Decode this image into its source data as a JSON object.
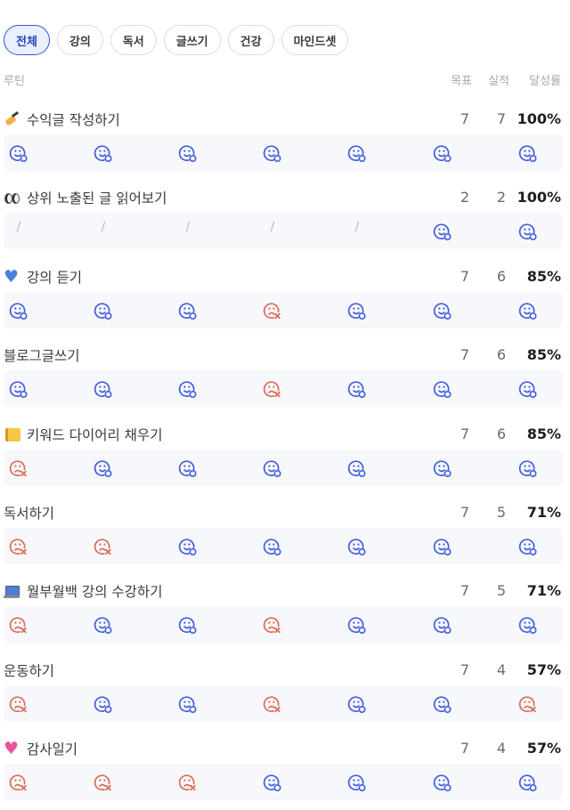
{
  "tabs": [
    "전체",
    "강의",
    "독서",
    "글쓰기",
    "건강",
    "마인드셋"
  ],
  "active_tab": 0,
  "header": {
    "name": "루틴",
    "goal": "목표",
    "actual": "실적",
    "rate": "달성률"
  },
  "colors": {
    "accent": "#3554d1",
    "success_icon": "#3f5ce0",
    "fail_icon": "#d96b55"
  },
  "routines": [
    {
      "emoji": "writing-hand",
      "title": "수익글 작성하기",
      "goal": "7",
      "actual": "7",
      "rate": "100%",
      "days": [
        "done",
        "done",
        "done",
        "done",
        "done",
        "done",
        "done"
      ]
    },
    {
      "emoji": "eyes",
      "title": "상위 노출된 글 읽어보기",
      "goal": "2",
      "actual": "2",
      "rate": "100%",
      "days": [
        "none",
        "none",
        "none",
        "none",
        "none",
        "done",
        "done"
      ]
    },
    {
      "emoji": "blue-heart",
      "title": "강의 듣기",
      "goal": "7",
      "actual": "6",
      "rate": "85%",
      "days": [
        "done",
        "done",
        "done",
        "fail",
        "done",
        "done",
        "done"
      ]
    },
    {
      "emoji": "",
      "title": "블로그글쓰기",
      "goal": "7",
      "actual": "6",
      "rate": "85%",
      "days": [
        "done",
        "done",
        "done",
        "fail",
        "done",
        "done",
        "done"
      ]
    },
    {
      "emoji": "notepad",
      "title": "키워드 다이어리 채우기",
      "goal": "7",
      "actual": "6",
      "rate": "85%",
      "days": [
        "fail",
        "done",
        "done",
        "done",
        "done",
        "done",
        "done"
      ]
    },
    {
      "emoji": "",
      "title": "독서하기",
      "goal": "7",
      "actual": "5",
      "rate": "71%",
      "days": [
        "fail",
        "fail",
        "done",
        "done",
        "done",
        "done",
        "done"
      ]
    },
    {
      "emoji": "laptop",
      "title": "월부월백 강의 수강하기",
      "goal": "7",
      "actual": "5",
      "rate": "71%",
      "days": [
        "fail",
        "done",
        "done",
        "fail",
        "done",
        "done",
        "done"
      ]
    },
    {
      "emoji": "",
      "title": "운동하기",
      "goal": "7",
      "actual": "4",
      "rate": "57%",
      "days": [
        "fail",
        "done",
        "done",
        "fail",
        "done",
        "done",
        "fail"
      ]
    },
    {
      "emoji": "pink-heart",
      "title": "감사일기",
      "goal": "7",
      "actual": "4",
      "rate": "57%",
      "days": [
        "fail",
        "fail",
        "fail",
        "done",
        "done",
        "done",
        "done"
      ]
    }
  ]
}
